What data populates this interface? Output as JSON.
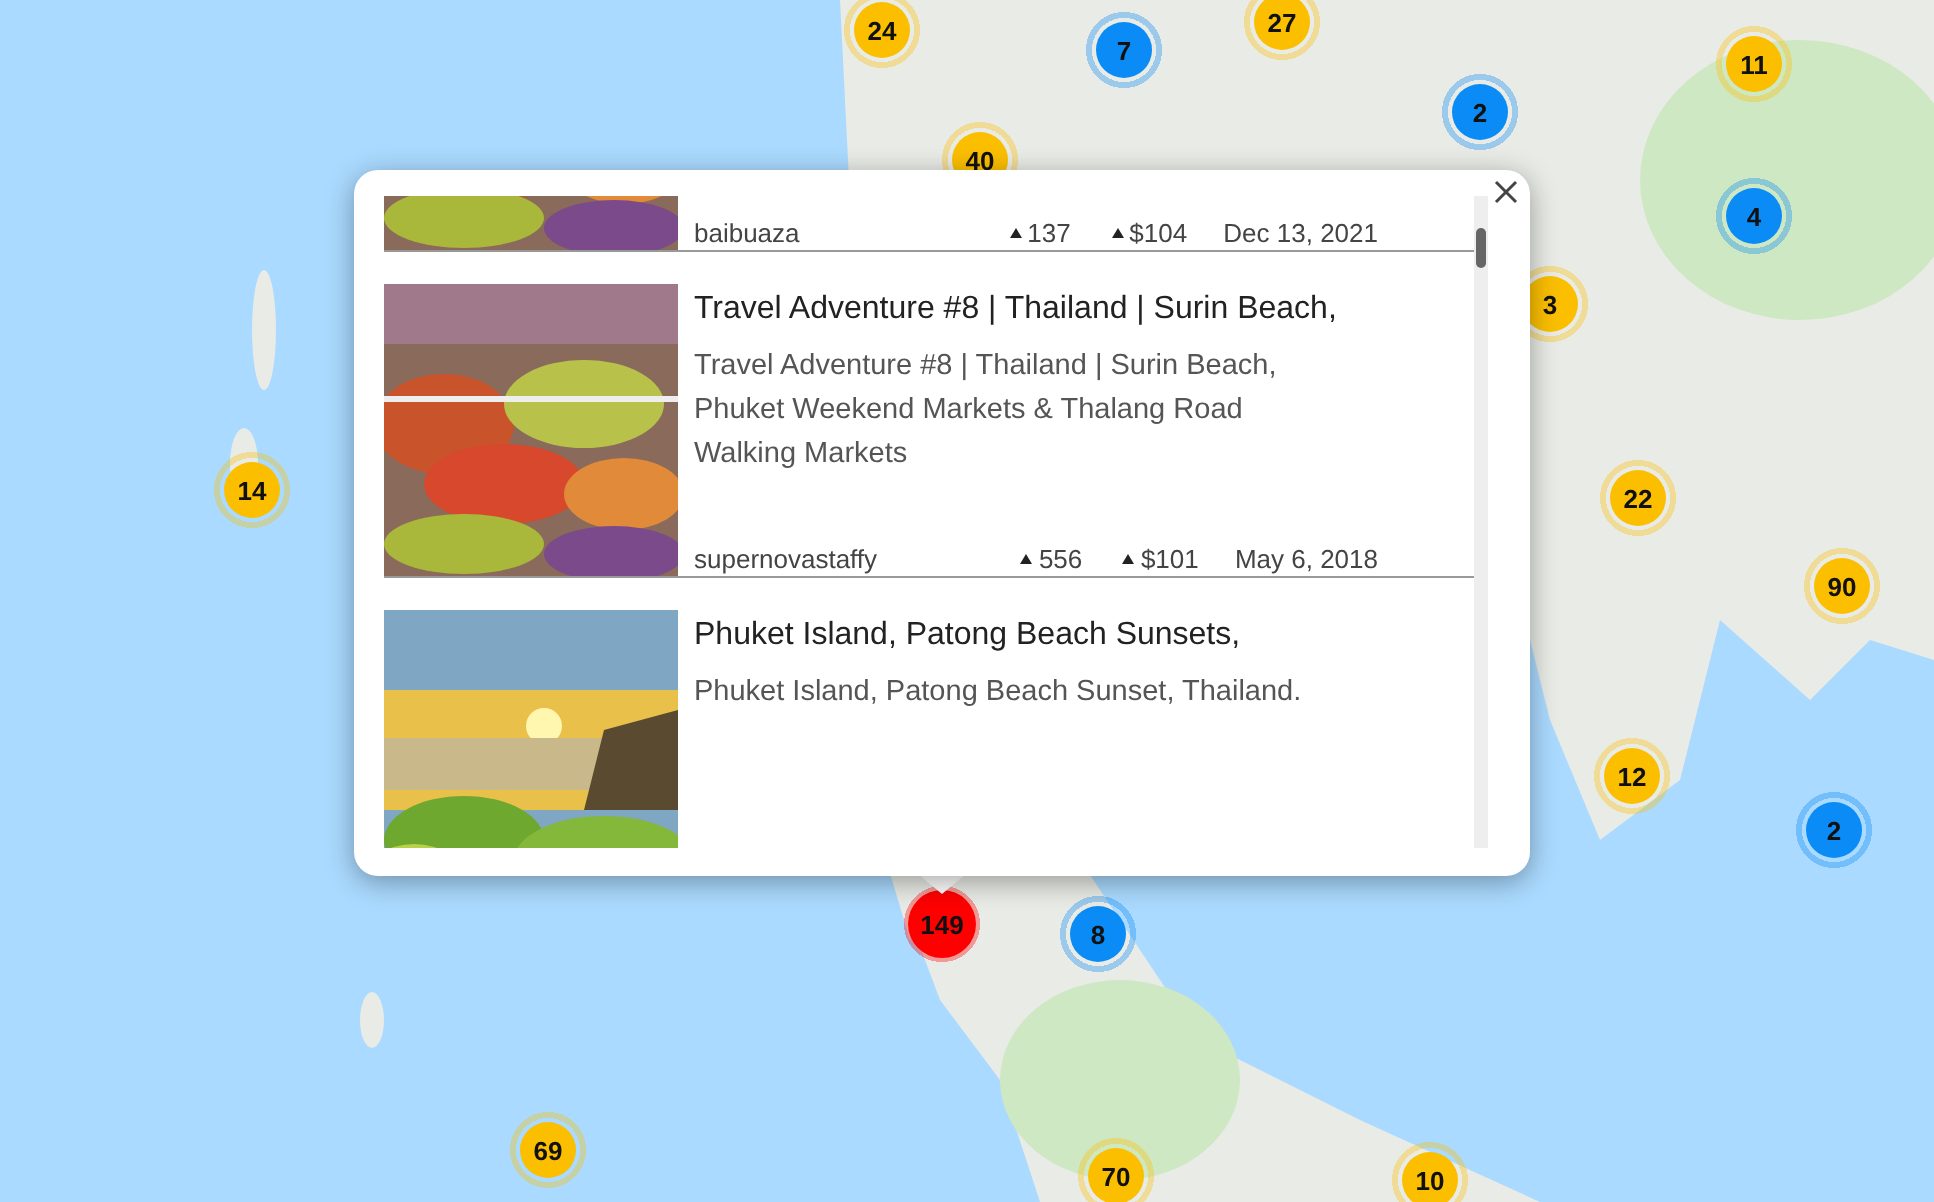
{
  "markers": [
    {
      "count": "24",
      "color": "#fbbf00"
    },
    {
      "count": "7",
      "color": "#0b8bf5"
    },
    {
      "count": "27",
      "color": "#fbbf00"
    },
    {
      "count": "2",
      "color": "#0b8bf5"
    },
    {
      "count": "11",
      "color": "#fbbf00"
    },
    {
      "count": "40",
      "color": "#fbbf00"
    },
    {
      "count": "4",
      "color": "#0b8bf5"
    },
    {
      "count": "3",
      "color": "#fbbf00"
    },
    {
      "count": "14",
      "color": "#fbbf00"
    },
    {
      "count": "22",
      "color": "#fbbf00"
    },
    {
      "count": "90",
      "color": "#fbbf00"
    },
    {
      "count": "12",
      "color": "#fbbf00"
    },
    {
      "count": "2",
      "color": "#0b8bf5"
    },
    {
      "count": "149",
      "color": "#ff0000"
    },
    {
      "count": "8",
      "color": "#0b8bf5"
    },
    {
      "count": "69",
      "color": "#fbbf00"
    },
    {
      "count": "70",
      "color": "#fbbf00"
    },
    {
      "count": "10",
      "color": "#fbbf00"
    }
  ],
  "popup": {
    "posts": [
      {
        "author": "baibuaza",
        "votes": "137",
        "payout": "$104",
        "date": "Dec 13, 2021"
      },
      {
        "title": "Travel Adventure #8 | Thailand | Surin Beach,",
        "description": "Travel Adventure #8 | Thailand | Surin Beach, Phuket Weekend Markets & Thalang Road Walking Markets",
        "author": "supernovastaffy",
        "votes": "556",
        "payout": "$101",
        "date": "May 6, 2018"
      },
      {
        "title": "Phuket Island, Patong Beach Sunsets,",
        "description": "Phuket Island, Patong Beach Sunset, Thailand."
      }
    ]
  }
}
